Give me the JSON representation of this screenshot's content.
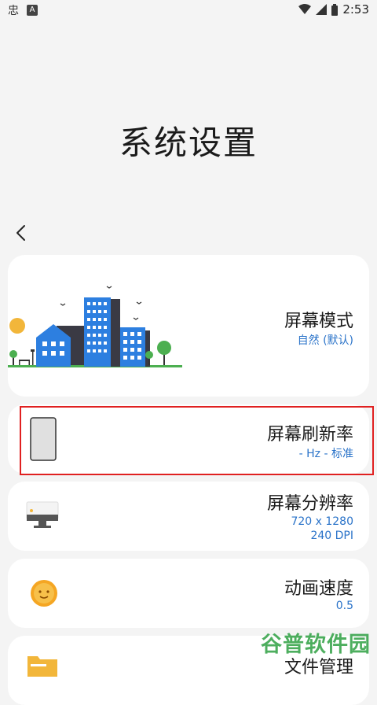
{
  "status_bar": {
    "time": "2:53",
    "icons": [
      "app-notification-icon",
      "a-app-icon",
      "wifi-icon",
      "cellular-icon",
      "battery-icon"
    ]
  },
  "page": {
    "title": "系统设置"
  },
  "settings": [
    {
      "title": "屏幕模式",
      "subtitle": "自然 (默认)",
      "icon": "city-illustration"
    },
    {
      "title": "屏幕刷新率",
      "subtitle": "- Hz - 标准",
      "icon": "phone-outline-icon"
    },
    {
      "title": "屏幕分辨率",
      "subtitle_line1": "720 x 1280",
      "subtitle_line2": "240 DPI",
      "icon": "monitor-icon"
    },
    {
      "title": "动画速度",
      "subtitle": "0.5",
      "icon": "sun-icon"
    },
    {
      "title": "文件管理",
      "icon": "folder-icon"
    }
  ],
  "watermark": "谷普软件园",
  "colors": {
    "accent": "#2a73c9",
    "highlight": "#e02020",
    "background": "#f4f4f4",
    "card": "#ffffff"
  }
}
